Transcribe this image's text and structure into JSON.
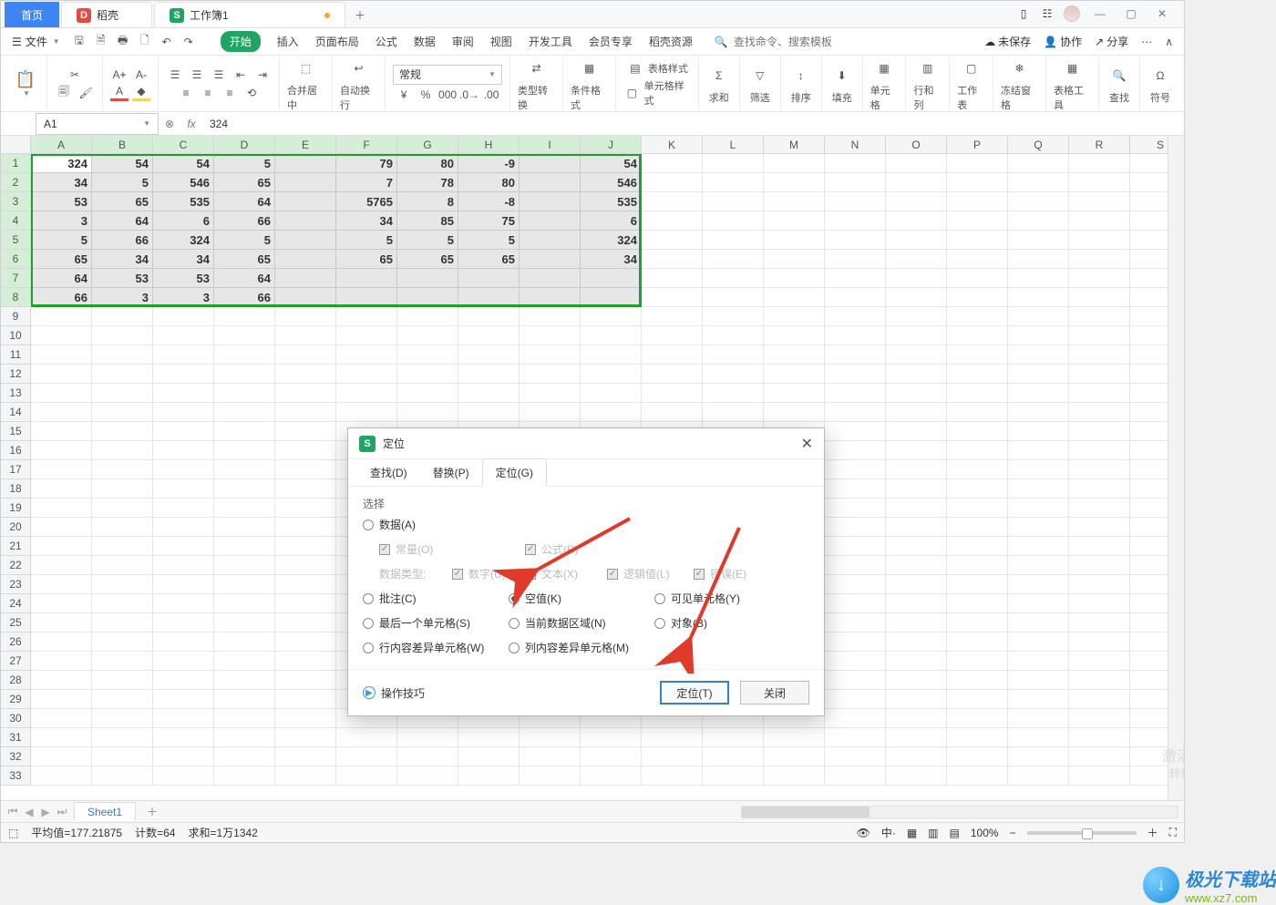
{
  "top_tabs": {
    "home": "首页",
    "docker": "稻壳",
    "workbook": "工作簿1"
  },
  "menu": {
    "file": "文件",
    "items": [
      "开始",
      "插入",
      "页面布局",
      "公式",
      "数据",
      "审阅",
      "视图",
      "开发工具",
      "会员专享",
      "稻壳资源"
    ],
    "search_placeholder": "查找命令、搜索模板",
    "right": {
      "unsaved": "未保存",
      "coop": "协作",
      "share": "分享"
    }
  },
  "ribbon": {
    "merge": "合并居中",
    "wrap": "自动换行",
    "num_format": "常规",
    "type_convert": "类型转换",
    "cond_format": "条件格式",
    "table_style": "表格样式",
    "cell_style": "单元格样式",
    "sum": "求和",
    "filter": "筛选",
    "sort": "排序",
    "fill": "填充",
    "cell": "单元格",
    "rowcol": "行和列",
    "sheet": "工作表",
    "freeze": "冻结窗格",
    "table_tools": "表格工具",
    "find": "查找",
    "symbol": "符号"
  },
  "formula_bar": {
    "cell_ref": "A1",
    "value": "324"
  },
  "columns": [
    "A",
    "B",
    "C",
    "D",
    "E",
    "F",
    "G",
    "H",
    "I",
    "J",
    "K",
    "L",
    "M",
    "N",
    "O",
    "P",
    "Q",
    "R",
    "S"
  ],
  "rows_shown": 33,
  "data_rows": [
    [
      "324",
      "54",
      "54",
      "5",
      "",
      "79",
      "80",
      "-9",
      "",
      "54"
    ],
    [
      "34",
      "5",
      "546",
      "65",
      "",
      "7",
      "78",
      "80",
      "",
      "546"
    ],
    [
      "53",
      "65",
      "535",
      "64",
      "",
      "5765",
      "8",
      "-8",
      "",
      "535"
    ],
    [
      "3",
      "64",
      "6",
      "66",
      "",
      "34",
      "85",
      "75",
      "",
      "6"
    ],
    [
      "5",
      "66",
      "324",
      "5",
      "",
      "5",
      "5",
      "5",
      "",
      "324"
    ],
    [
      "65",
      "34",
      "34",
      "65",
      "",
      "65",
      "65",
      "65",
      "",
      "34"
    ],
    [
      "64",
      "53",
      "53",
      "64",
      "",
      "",
      "",
      "",
      "",
      ""
    ],
    [
      "66",
      "3",
      "3",
      "66",
      "",
      "",
      "",
      "",
      "",
      ""
    ]
  ],
  "dialog": {
    "title": "定位",
    "tabs": {
      "find": "查找(D)",
      "replace": "替换(P)",
      "goto": "定位(G)"
    },
    "section": "选择",
    "opt_data": "数据(A)",
    "cb_const": "常量(O)",
    "cb_formula": "公式(R)",
    "datatype_label": "数据类型:",
    "cb_number": "数字(U)",
    "cb_text": "文本(X)",
    "cb_logic": "逻辑值(L)",
    "cb_error": "错误(E)",
    "opt_comment": "批注(C)",
    "opt_blank": "空值(K)",
    "opt_visible": "可见单元格(Y)",
    "opt_last": "最后一个单元格(S)",
    "opt_region": "当前数据区域(N)",
    "opt_object": "对象(B)",
    "opt_rowdiff": "行内容差异单元格(W)",
    "opt_coldiff": "列内容差异单元格(M)",
    "tips": "操作技巧",
    "btn_ok": "定位(T)",
    "btn_close": "关闭"
  },
  "sheet_tab": "Sheet1",
  "status": {
    "avg": "平均值=177.21875",
    "count": "计数=64",
    "sum": "求和=1万1342",
    "zoom": "100%"
  },
  "watermark": {
    "l1": "激活",
    "l2": "转到"
  },
  "logo": {
    "text": "极光下载站",
    "url": "www.xz7.com"
  }
}
